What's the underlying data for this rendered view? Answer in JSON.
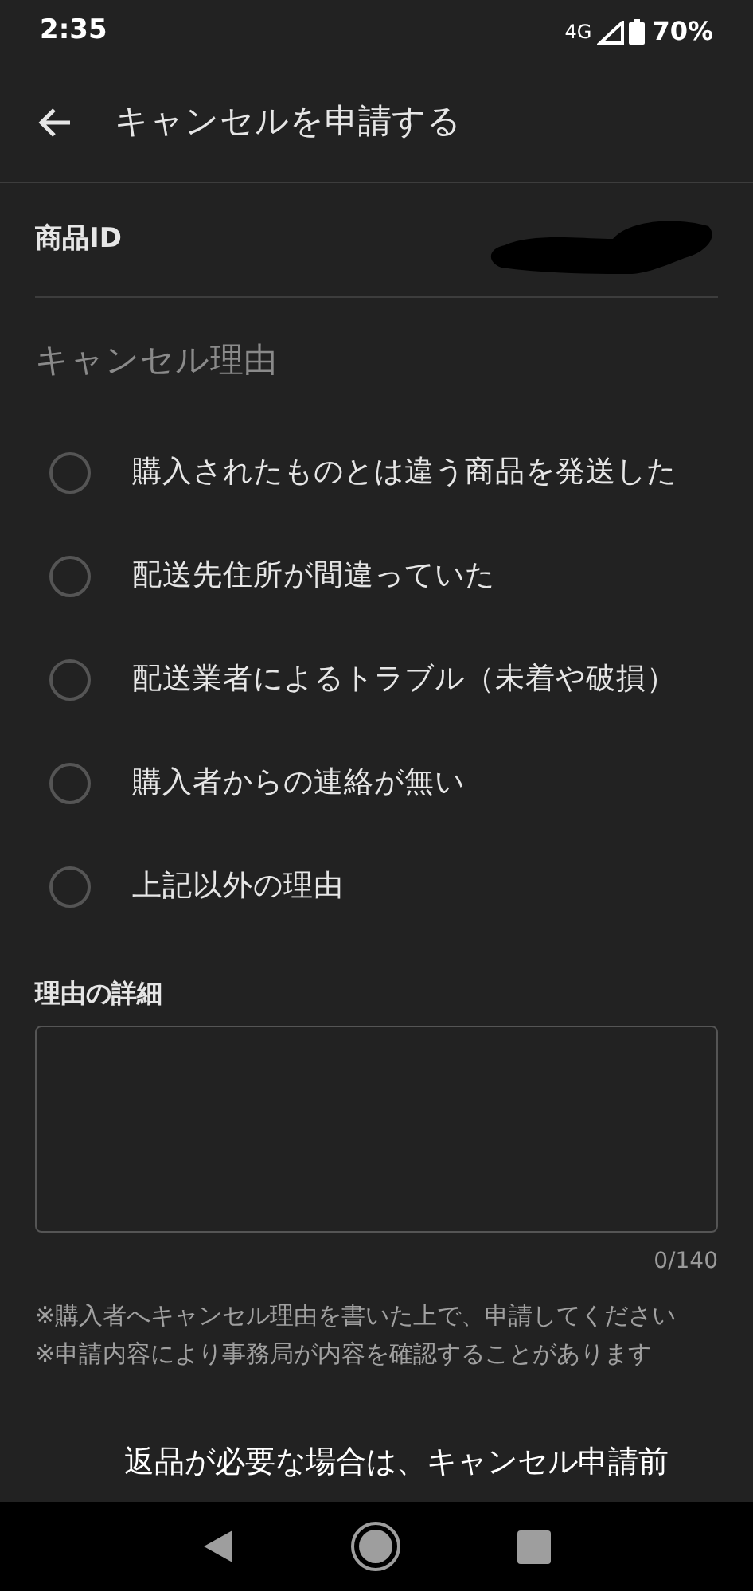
{
  "status_bar": {
    "time": "2:35",
    "network": "4G",
    "battery": "70%"
  },
  "header": {
    "title": "キャンセルを申請する"
  },
  "product_id": {
    "label": "商品ID",
    "redacted": true
  },
  "reason_section": {
    "title": "キャンセル理由"
  },
  "reasons": [
    {
      "label": "購入されたものとは違う商品を発送した",
      "selected": false
    },
    {
      "label": "配送先住所が間違っていた",
      "selected": false
    },
    {
      "label": "配送業者によるトラブル（未着や破損）",
      "selected": false
    },
    {
      "label": "購入者からの連絡が無い",
      "selected": false
    },
    {
      "label": "上記以外の理由",
      "selected": false
    }
  ],
  "details": {
    "label": "理由の詳細",
    "counter": "0/140"
  },
  "notes": [
    "※購入者へキャンセル理由を書いた上で、申請してください",
    "※申請内容により事務局が内容を確認することがあります"
  ],
  "return_notice": "返品が必要な場合は、キャンセル申請前"
}
